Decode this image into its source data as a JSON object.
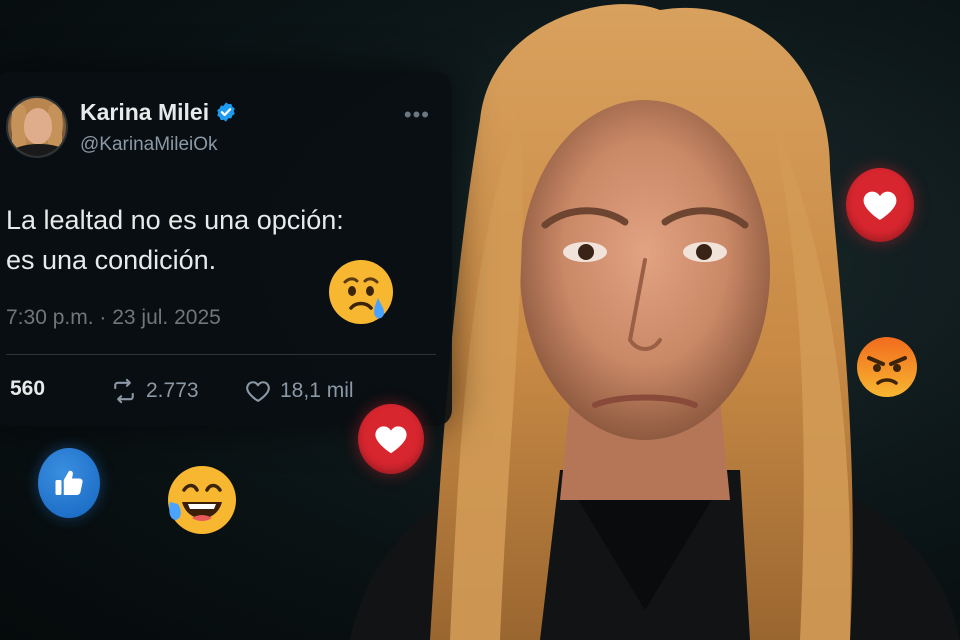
{
  "tweet": {
    "author": {
      "display_name": "Karina Milei",
      "handle": "@KarinaMileiOk",
      "verified": true
    },
    "text_line1": "La lealtad no es una opción:",
    "text_line2": "es una condición.",
    "timestamp": "7:30 p.m. · 23 jul. 2025",
    "stats": {
      "replies": "560",
      "retweets": "2.773",
      "likes": "18,1 mil"
    }
  },
  "icons": {
    "verified": "verified-badge-icon",
    "more": "more-options-icon",
    "retweet": "retweet-icon",
    "like": "heart-outline-icon"
  },
  "reactions": [
    "crying-face-emoji",
    "heart-reaction",
    "thumbs-up-reaction",
    "laughing-tears-emoji",
    "heart-reaction",
    "angry-face-emoji"
  ],
  "colors": {
    "background": "#0b1416",
    "card": "#090e11",
    "text_primary": "#e7e9ea",
    "text_secondary": "#8b98a5",
    "verified": "#1d9bf0",
    "heart_reaction": "#d8262f",
    "like_reaction": "#1877f2"
  }
}
